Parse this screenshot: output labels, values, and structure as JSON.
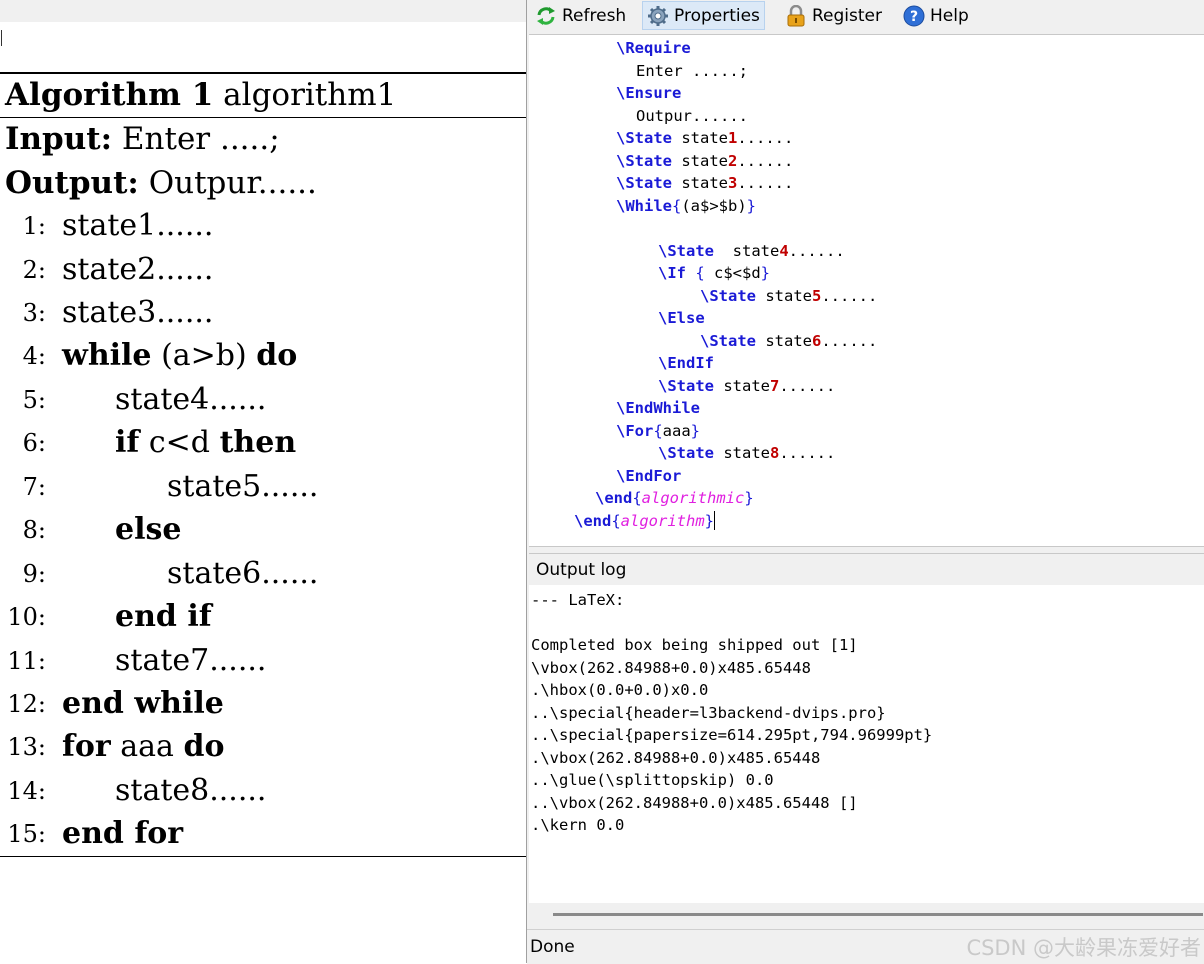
{
  "preview": {
    "caption_label": "Algorithm 1",
    "caption_title": "algorithm1",
    "input_label": "Input:",
    "input_text": "Enter .....;",
    "output_label": "Output:",
    "output_text": "Outpur......",
    "lines": [
      {
        "num": "1:",
        "text": "state1......"
      },
      {
        "num": "2:",
        "text": "state2......"
      },
      {
        "num": "3:",
        "text": "state3......"
      },
      {
        "num": "4:",
        "kw1": "while",
        "text": "(a>b)",
        "kw2": "do"
      },
      {
        "num": "5:",
        "text": "state4......"
      },
      {
        "num": "6:",
        "kw1": "if",
        "text": "c<d",
        "kw2": "then"
      },
      {
        "num": "7:",
        "text": "state5......"
      },
      {
        "num": "8:",
        "kw1": "else"
      },
      {
        "num": "9:",
        "text": "state6......"
      },
      {
        "num": "10:",
        "kw1": "end if"
      },
      {
        "num": "11:",
        "text": "state7......"
      },
      {
        "num": "12:",
        "kw1": "end while"
      },
      {
        "num": "13:",
        "kw1": "for",
        "text": "aaa",
        "kw2": "do"
      },
      {
        "num": "14:",
        "text": "state8......"
      },
      {
        "num": "15:",
        "kw1": "end for"
      }
    ]
  },
  "toolbar": {
    "refresh_label": "Refresh",
    "properties_label": "Properties",
    "register_label": "Register",
    "help_label": "Help"
  },
  "editor": {
    "code": [
      {
        "cmd": "\\Require"
      },
      {
        "text": "Enter .....;"
      },
      {
        "cmd": "\\Ensure"
      },
      {
        "text": "Outpur......"
      },
      {
        "cmd": "\\State",
        "text": " state",
        "num": "1",
        "tail": "......"
      },
      {
        "cmd": "\\State",
        "text": " state",
        "num": "2",
        "tail": "......"
      },
      {
        "cmd": "\\State",
        "text": " state",
        "num": "3",
        "tail": "......"
      },
      {
        "cmd": "\\While",
        "brace_open": "{",
        "text": "(a$>$b)",
        "brace_close": "}"
      },
      {},
      {
        "cmd": "\\State",
        "text": "  state",
        "num": "4",
        "tail": "......"
      },
      {
        "cmd": "\\If",
        "brace_open": " {",
        "text": " c$<$d",
        "brace_close": "}"
      },
      {
        "cmd": "\\State",
        "text": " state",
        "num": "5",
        "tail": "......"
      },
      {
        "cmd": "\\Else"
      },
      {
        "cmd": "\\State",
        "text": " state",
        "num": "6",
        "tail": "......"
      },
      {
        "cmd": "\\EndIf"
      },
      {
        "cmd": "\\State",
        "text": " state",
        "num": "7",
        "tail": "......"
      },
      {
        "cmd": "\\EndWhile"
      },
      {
        "cmd": "\\For",
        "brace_open": "{",
        "text": "aaa",
        "brace_close": "}"
      },
      {
        "cmd": "\\State",
        "text": " state",
        "num": "8",
        "tail": "......"
      },
      {
        "cmd": "\\EndFor"
      },
      {
        "cmd": "\\end",
        "brace_open": "{",
        "env": "algorithmic",
        "brace_close": "}"
      },
      {
        "cmd": "\\end",
        "brace_open": "{",
        "env": "algorithm",
        "brace_close": "}"
      }
    ]
  },
  "output": {
    "header": "Output log",
    "lines": [
      "--- LaTeX:",
      "",
      "Completed box being shipped out [1]",
      "\\vbox(262.84988+0.0)x485.65448",
      ".\\hbox(0.0+0.0)x0.0",
      "..\\special{header=l3backend-dvips.pro}",
      "..\\special{papersize=614.295pt,794.96999pt}",
      ".\\vbox(262.84988+0.0)x485.65448",
      "..\\glue(\\splittopskip) 0.0",
      "..\\vbox(262.84988+0.0)x485.65448 []",
      ".\\kern 0.0"
    ]
  },
  "status": {
    "text": "Done",
    "watermark": "CSDN @大龄果冻爱好者"
  },
  "colors": {
    "command_blue": "#1a1ad6",
    "number_red": "#c00000",
    "env_magenta": "#e020e0"
  },
  "icons": {
    "refresh": "refresh-icon",
    "properties": "gear-icon",
    "register": "lock-icon",
    "help": "help-icon"
  }
}
